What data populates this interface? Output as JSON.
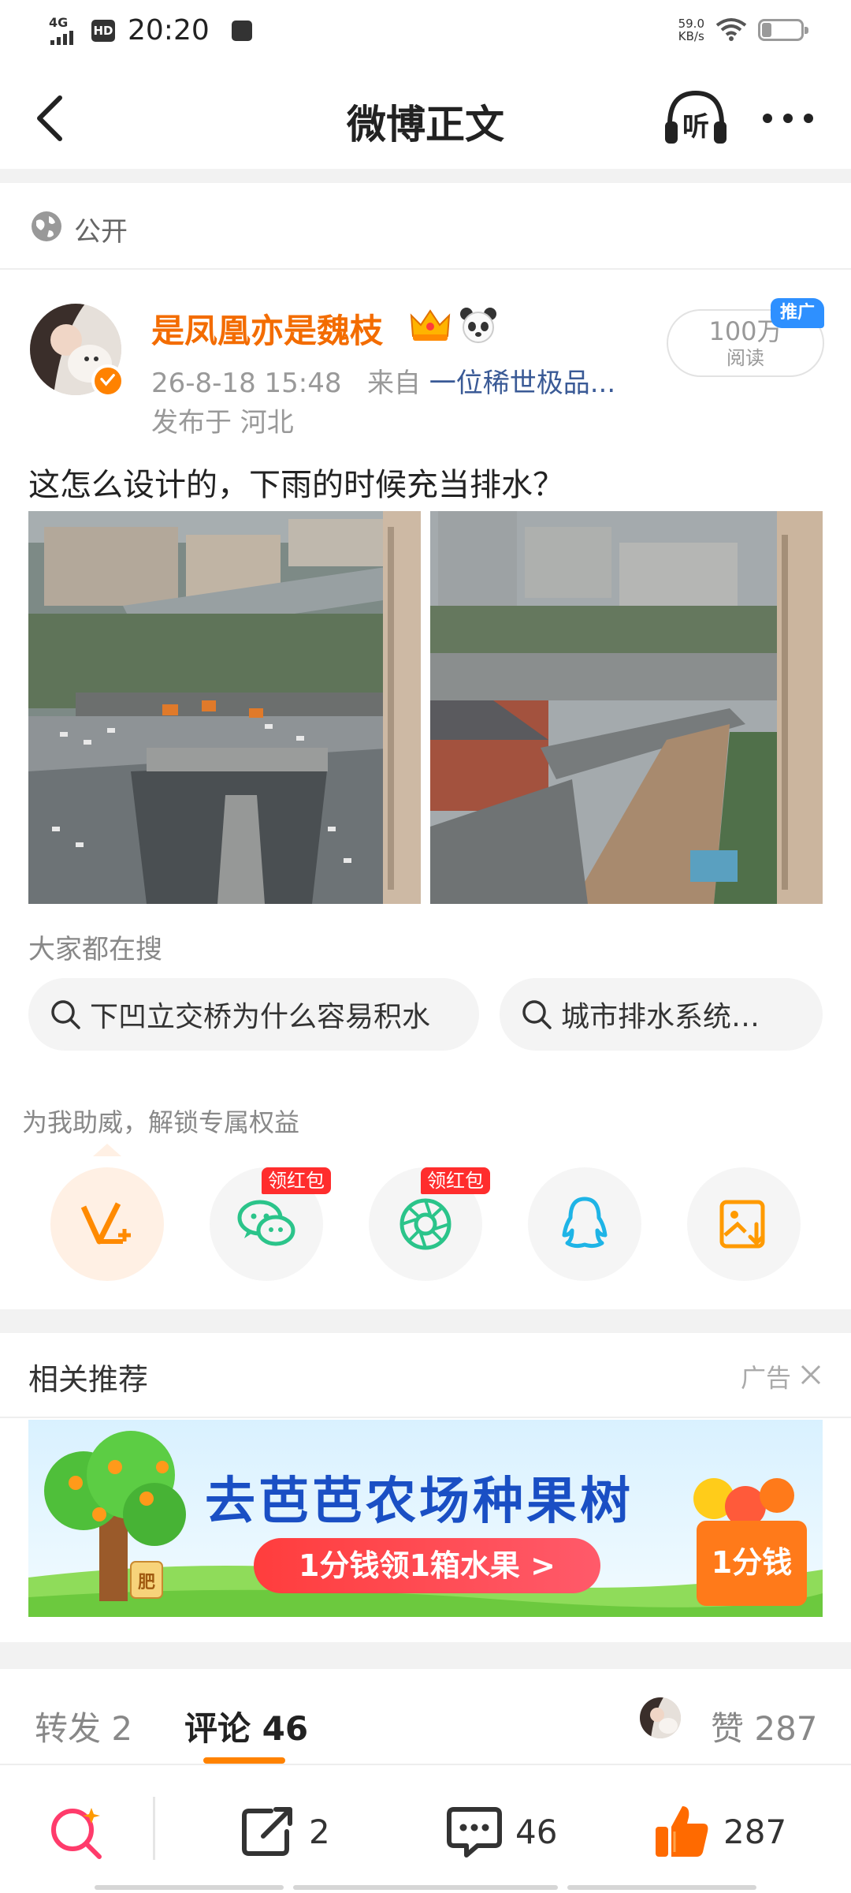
{
  "status_bar": {
    "network": "4G",
    "hd": "HD",
    "time": "20:20",
    "speed_value": "59.0",
    "speed_unit": "KB/s",
    "battery": "1"
  },
  "nav": {
    "title": "微博正文",
    "listen_label": "听"
  },
  "visibility": {
    "label": "公开"
  },
  "post": {
    "username": "是凤凰亦是魏枝",
    "timestamp": "26-8-18 15:48",
    "source_prefix": "来自",
    "source": "一位稀世极品...",
    "location": "发布于 河北",
    "reads_count": "100万",
    "reads_label": "阅读",
    "promo_tag": "推广",
    "text": "这怎么设计的，下雨的时候充当排水？"
  },
  "search": {
    "label": "大家都在搜",
    "chips": [
      "下凹立交桥为什么容易积水",
      "城市排水系统…"
    ]
  },
  "support": {
    "label": "为我助威，解锁专属权益",
    "red_tag_wechat": "领红包",
    "red_tag_moments": "领红包"
  },
  "recommend": {
    "title": "相关推荐",
    "ad_label": "广告",
    "banner_title": "去芭芭农场种果树",
    "banner_button": "1分钱领1箱水果 >",
    "banner_box": "1分钱",
    "banner_sign": "肥"
  },
  "tabs": {
    "repost": "转发 2",
    "comment": "评论 46",
    "like": "赞 287"
  },
  "bottom_bar": {
    "repost_count": "2",
    "comment_count": "46",
    "like_count": "287"
  },
  "colors": {
    "accent": "#ff8200",
    "username": "#f36c00",
    "link": "#3a5a96",
    "promo": "#2e90ff",
    "red_tag": "#ff2d2d"
  }
}
